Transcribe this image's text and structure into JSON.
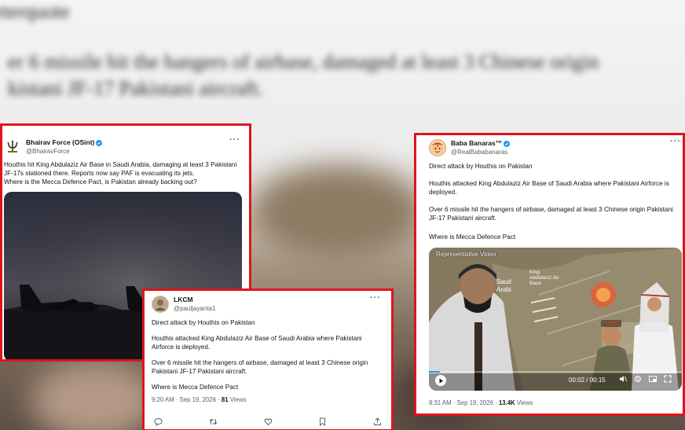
{
  "background": {
    "line1": "eterquote",
    "line2": "er 6 missile hit the hangers of airbase, damaged at least 3 Chinese origin",
    "line3": "kistani JF-17 Pakistani aircraft."
  },
  "tweets": [
    {
      "display_name": "Bhairav Force (OSint)",
      "handle": "@BhairavForce",
      "more": "···",
      "body": "Houthis hit King Abdulaziz Air Base in Saudi Arabia, damaging at least 3 Pakistani JF-17s stationed there. Reports now say PAF is evacuating its jets.",
      "body2": "Where is the Mecca Defence Pact, is Pakistan already backing out?"
    },
    {
      "display_name": "LKCM",
      "handle": "@pauljayanta1",
      "more": "···",
      "p1": "Direct attack by Houthis on Pakistan",
      "p2": "Houthis attacked King Abdulaziz Air Base of Saudi Arabia where Pakistani Airforce is deployed.",
      "p3": "Over 6 missile hit the hangers of airbase, damaged at least 3 Chinese origin Pakistani JF-17 Pakistani aircraft.",
      "p4": "Where is Mecca Defence Pact",
      "time": "9:20 AM · Sep 19, 2026 · ",
      "views_count": "81",
      "views_label": " Views"
    },
    {
      "display_name": "Baba Banaras™",
      "handle": "@RealBababanaras",
      "more": "···",
      "p1": "Direct attack by Houthis on Pakistan",
      "p2": "Houthis attacked King Abdulaziz Air Base of Saudi Arabia where Pakistani Airforce is deployed.",
      "p3": "Over 6 missile hit the hangers of airbase, damaged at least 3 Chinese origin Pakistani JF-17 Pakistani aircraft.",
      "p4": "Where is Mecca Defence Pact",
      "video_label": "Representative Video",
      "map_label_1": "Saud",
      "map_label_2": "Arabi",
      "map_label_3": "King Abdulaziz Air Base",
      "time_current": "00:02",
      "time_total": "00:15",
      "time": "8:31 AM · Sep 19, 2026 · ",
      "views_count": "13.4K",
      "views_label": " Views"
    }
  ],
  "colors": {
    "highlight_border": "#e0141c",
    "verified": "#1d9bf0",
    "muted_text": "#536471"
  },
  "icons": [
    "verified-badge-icon",
    "more-options-icon",
    "reply-icon",
    "repost-icon",
    "like-icon",
    "bookmark-icon",
    "share-icon",
    "play-icon",
    "volume-icon",
    "settings-icon",
    "pip-icon",
    "fullscreen-icon"
  ]
}
